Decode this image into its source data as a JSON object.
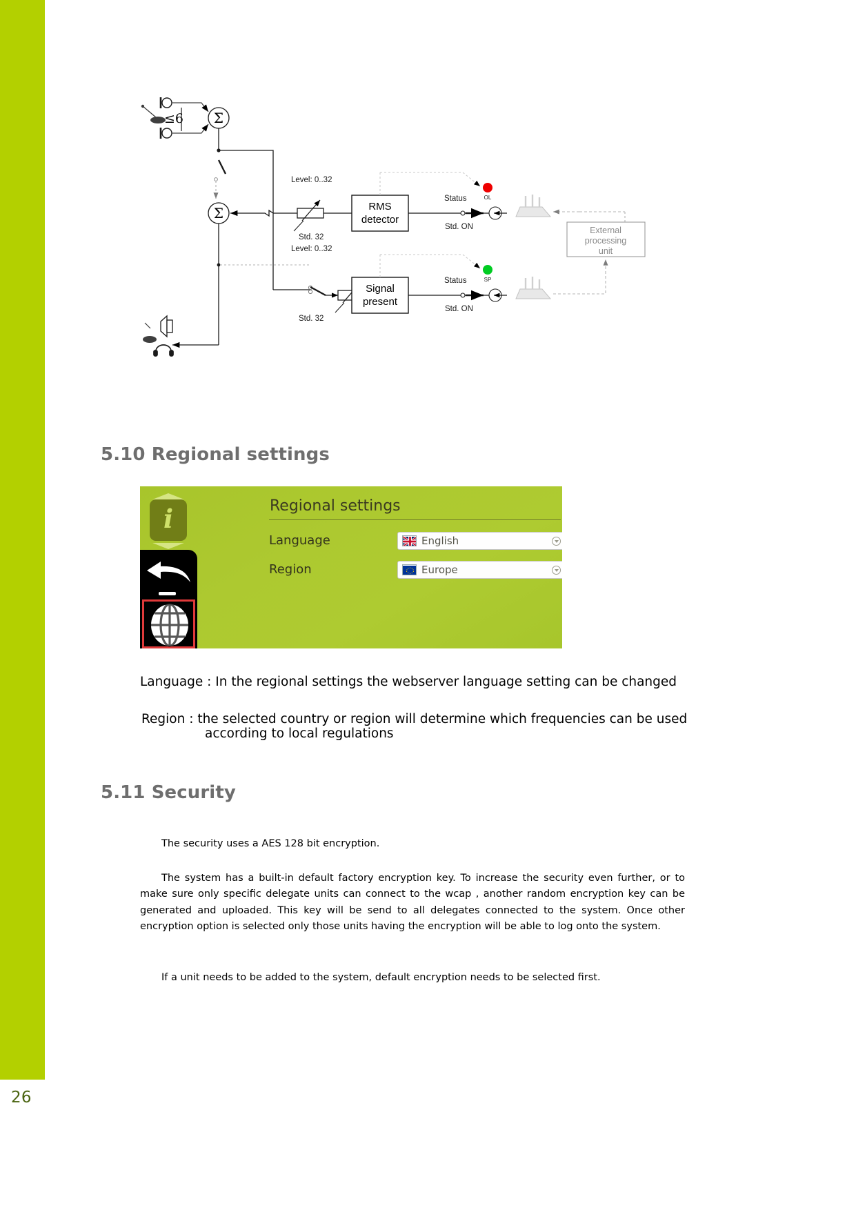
{
  "page": {
    "number": "26"
  },
  "diagram": {
    "labels": {
      "le6": "≤6",
      "sigma": "Σ",
      "level_top": "Level: 0..32",
      "std_top": "Std. 32",
      "level_bottom": "Level: 0..32",
      "std_bottom": "Std. 32",
      "rms_line1": "RMS",
      "rms_line2": "detector",
      "signal_line1": "Signal",
      "signal_line2": "present",
      "status_top": "Status",
      "status_bottom": "Status",
      "std_on_top": "Std. ON",
      "std_on_bottom": "Std. ON",
      "led_ol": "OL",
      "led_sp": "SP",
      "external_line1": "External",
      "external_line2": "processing",
      "external_line3": "unit"
    },
    "colors": {
      "led_ol": "#ee0000",
      "led_sp": "#00cc22",
      "external_box": "#8a8a8a"
    }
  },
  "sections": {
    "regional": {
      "heading": "5.10 Regional settings",
      "paragraphs": {
        "language": "Language : In the regional settings the webserver language setting can be changed",
        "region_line1": "Region : the selected country or region will determine which frequencies can be used",
        "region_line2": "according to local regulations"
      }
    },
    "security": {
      "heading": "5.11 Security",
      "paragraphs": {
        "p1": "The security uses a AES 128 bit encryption.",
        "p2": "The system has a built-in default factory encryption key. To increase the security even further, or to make sure only specific delegate units can connect to the wcap , another random encryption key can be generated and uploaded. This key will be send to all delegates connected to the system. Once other encryption option is selected only those units having the encryption will be able to log onto the system.",
        "p3": "If a unit needs to be added to the system, default encryption needs to be selected first."
      }
    }
  },
  "web_ui": {
    "title": "Regional settings",
    "info_icon_letter": "i",
    "rows": [
      {
        "label": "Language",
        "value": "English",
        "flag": "uk-flag-icon"
      },
      {
        "label": "Region",
        "value": "Europe",
        "flag": "eu-flag-icon"
      }
    ],
    "sidebar_icons": [
      "back-arrow-icon",
      "globe-icon"
    ],
    "colors": {
      "panel_green": "#adc930",
      "info_badge": "#717e17",
      "selection_outline": "#e03a3a",
      "band_green": "#b3d000",
      "page_number": "#4a6410"
    }
  }
}
